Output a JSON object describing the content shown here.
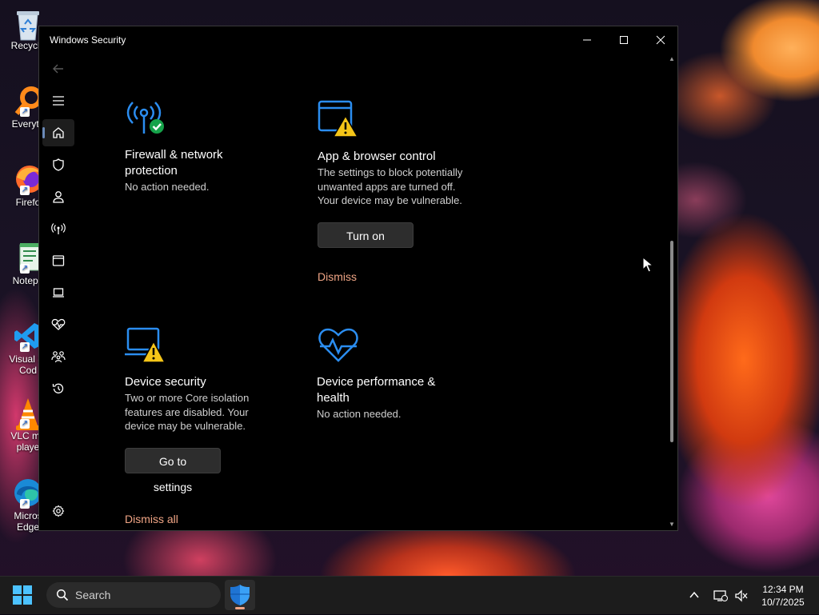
{
  "desktop": {
    "icons": [
      {
        "label": "Recycle",
        "icon": "recycle-bin-icon"
      },
      {
        "label": "Everyth",
        "icon": "everything-search-icon"
      },
      {
        "label": "Firefo",
        "icon": "firefox-icon"
      },
      {
        "label": "Notepa",
        "icon": "notepad-icon"
      },
      {
        "label": "Visual St\nCod",
        "icon": "vscode-icon"
      },
      {
        "label": "VLC me\nplaye",
        "icon": "vlc-icon"
      },
      {
        "label": "Micros\nEdge",
        "icon": "edge-icon"
      }
    ]
  },
  "window": {
    "title": "Windows Security",
    "controls": {
      "minimize": "minimize-icon",
      "maximize": "maximize-icon",
      "close": "close-icon"
    },
    "nav": [
      {
        "name": "back-arrow-icon"
      },
      {
        "name": "hamburger-menu-icon"
      },
      {
        "name": "home-icon",
        "active": true
      },
      {
        "name": "shield-icon"
      },
      {
        "name": "person-icon"
      },
      {
        "name": "wireless-signal-icon"
      },
      {
        "name": "app-window-icon"
      },
      {
        "name": "laptop-icon"
      },
      {
        "name": "heart-pulse-icon"
      },
      {
        "name": "family-icon"
      },
      {
        "name": "history-icon"
      },
      {
        "name": "settings-gear-icon"
      }
    ],
    "cards": {
      "firewall": {
        "icon": "firewall-network-icon",
        "title": "Firewall & network protection",
        "desc": "No action needed."
      },
      "app_browser": {
        "icon": "app-browser-warning-icon",
        "title": "App & browser control",
        "desc": "The settings to block potentially unwanted apps are turned off. Your device may be vulnerable.",
        "button": "Turn on",
        "link": "Dismiss"
      },
      "device_security": {
        "icon": "device-security-warning-icon",
        "title": "Device security",
        "desc": "Two or more Core isolation features are disabled.  Your device may be vulnerable.",
        "button": "Go to settings",
        "link": "Dismiss all"
      },
      "performance": {
        "icon": "device-performance-heart-icon",
        "title": "Device performance & health",
        "desc": "No action needed."
      }
    }
  },
  "taskbar": {
    "search_placeholder": "Search",
    "time": "12:34 PM",
    "date": "10/7/2025",
    "colors": {
      "accent": "#4cc2ff",
      "link": "#f0a585",
      "warning": "#f5c518",
      "ok": "#16a34a",
      "icon_blue": "#2b8df0"
    }
  }
}
